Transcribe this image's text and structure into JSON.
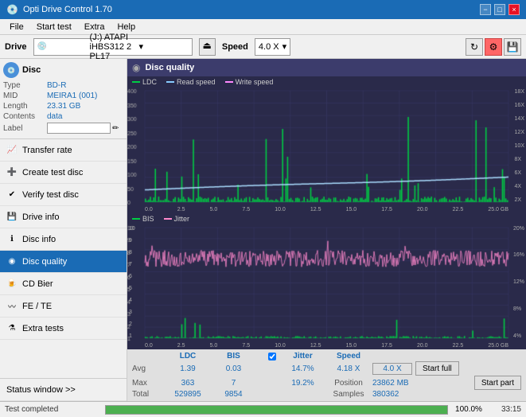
{
  "titleBar": {
    "appName": "Opti Drive Control 1.70",
    "controls": [
      "−",
      "□",
      "×"
    ]
  },
  "menuBar": {
    "items": [
      "File",
      "Start test",
      "Extra",
      "Help"
    ]
  },
  "driveBar": {
    "driveLabel": "Drive",
    "driveValue": "(J:)  ATAPI iHBS312  2 PL17",
    "speedLabel": "Speed",
    "speedValue": "4.0 X"
  },
  "disc": {
    "title": "Disc",
    "type": {
      "key": "Type",
      "value": "BD-R"
    },
    "mid": {
      "key": "MID",
      "value": "MEIRA1 (001)"
    },
    "length": {
      "key": "Length",
      "value": "23.31 GB"
    },
    "contents": {
      "key": "Contents",
      "value": "data"
    },
    "label": {
      "key": "Label",
      "value": ""
    }
  },
  "sidebar": {
    "items": [
      {
        "id": "transfer-rate",
        "label": "Transfer rate",
        "active": false
      },
      {
        "id": "create-test-disc",
        "label": "Create test disc",
        "active": false
      },
      {
        "id": "verify-test-disc",
        "label": "Verify test disc",
        "active": false
      },
      {
        "id": "drive-info",
        "label": "Drive info",
        "active": false
      },
      {
        "id": "disc-info",
        "label": "Disc info",
        "active": false
      },
      {
        "id": "disc-quality",
        "label": "Disc quality",
        "active": true
      },
      {
        "id": "cd-bier",
        "label": "CD Bier",
        "active": false
      },
      {
        "id": "fe-te",
        "label": "FE / TE",
        "active": false
      },
      {
        "id": "extra-tests",
        "label": "Extra tests",
        "active": false
      }
    ],
    "statusWindow": "Status window >>"
  },
  "discQuality": {
    "title": "Disc quality",
    "legend": {
      "ldc": "LDC",
      "readSpeed": "Read speed",
      "writeSpeed": "Write speed",
      "bis": "BIS",
      "jitter": "Jitter"
    },
    "topChart": {
      "yMax": 400,
      "yLabels": [
        "18X",
        "16X",
        "14X",
        "12X",
        "10X",
        "8X",
        "6X",
        "4X",
        "2X"
      ],
      "xLabels": [
        "0.0",
        "2.5",
        "5.0",
        "7.5",
        "10.0",
        "12.5",
        "15.0",
        "17.5",
        "20.0",
        "22.5",
        "25.0 GB"
      ]
    },
    "bottomChart": {
      "yLabels": [
        "10",
        "9",
        "8",
        "7",
        "6",
        "5",
        "4",
        "3",
        "2",
        "1"
      ],
      "yRightLabels": [
        "20%",
        "16%",
        "12%",
        "8%",
        "4%"
      ],
      "xLabels": [
        "0.0",
        "2.5",
        "5.0",
        "7.5",
        "10.0",
        "12.5",
        "15.0",
        "17.5",
        "20.0",
        "22.5",
        "25.0 GB"
      ]
    }
  },
  "stats": {
    "headers": [
      "LDC",
      "BIS",
      "",
      "Jitter",
      "Speed",
      ""
    ],
    "avg": {
      "label": "Avg",
      "ldc": "1.39",
      "bis": "0.03",
      "jitter": "14.7%",
      "speed": "4.18 X",
      "speedTarget": "4.0 X"
    },
    "max": {
      "label": "Max",
      "ldc": "363",
      "bis": "7",
      "jitter": "19.2%",
      "position": "23862 MB"
    },
    "total": {
      "label": "Total",
      "ldc": "529895",
      "bis": "9854",
      "samples": "380362"
    },
    "positionLabel": "Position",
    "samplesLabel": "Samples",
    "jitterChecked": true,
    "startFull": "Start full",
    "startPart": "Start part"
  },
  "statusBar": {
    "text": "Test completed",
    "progress": 100,
    "progressText": "100.0%",
    "time": "33:15"
  },
  "colors": {
    "ldcBar": "#00cc44",
    "readSpeedLine": "#88ccff",
    "bisBar": "#00cc44",
    "jitterLine": "#ff88cc",
    "background": "#2a2a4a",
    "gridLine": "#3a3a6a",
    "accent": "#1a6bb5"
  }
}
